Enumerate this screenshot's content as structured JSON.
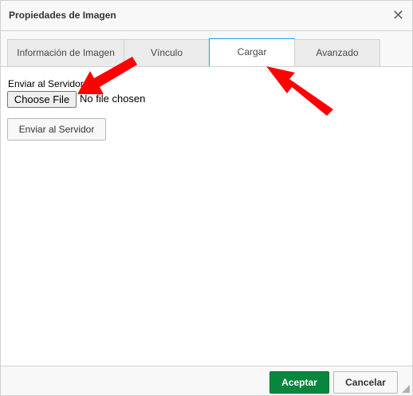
{
  "dialog": {
    "title": "Propiedades de Imagen",
    "close_glyph": "✕",
    "close_icon": "close-icon"
  },
  "tabs": [
    {
      "label": "Información de Imagen",
      "active": false
    },
    {
      "label": "Vínculo",
      "active": false
    },
    {
      "label": "Cargar",
      "active": true
    },
    {
      "label": "Avanzado",
      "active": false
    }
  ],
  "upload": {
    "field_label": "Enviar al Servidor",
    "choose_file_label": "Choose File",
    "no_file_text": "No file chosen",
    "send_button_label": "Enviar al Servidor"
  },
  "footer": {
    "ok_label": "Aceptar",
    "cancel_label": "Cancelar"
  },
  "colors": {
    "accent_tab_border": "#139ff7",
    "ok_button": "#09863e",
    "annotation_arrow": "#ff0000"
  }
}
